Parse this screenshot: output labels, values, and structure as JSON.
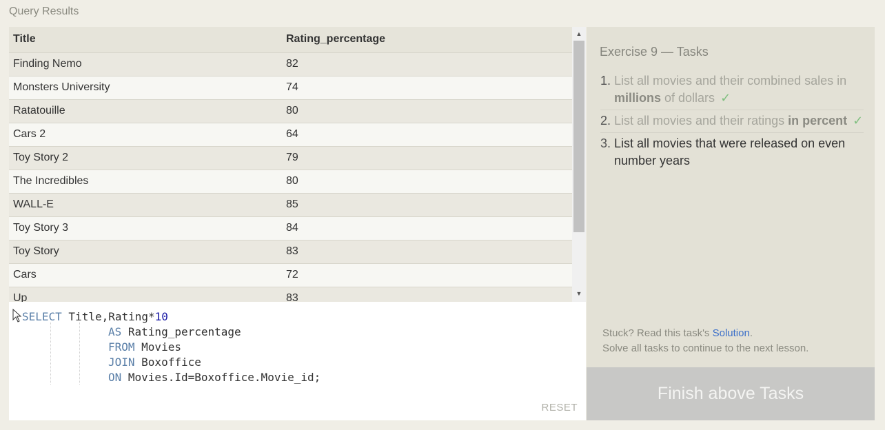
{
  "results": {
    "label": "Query Results",
    "columns": [
      "Title",
      "Rating_percentage"
    ],
    "rows": [
      [
        "Finding Nemo",
        "82"
      ],
      [
        "Monsters University",
        "74"
      ],
      [
        "Ratatouille",
        "80"
      ],
      [
        "Cars 2",
        "64"
      ],
      [
        "Toy Story 2",
        "79"
      ],
      [
        "The Incredibles",
        "80"
      ],
      [
        "WALL-E",
        "85"
      ],
      [
        "Toy Story 3",
        "84"
      ],
      [
        "Toy Story",
        "83"
      ],
      [
        "Cars",
        "72"
      ],
      [
        "Up",
        "83"
      ]
    ]
  },
  "editor": {
    "line1_kw": "SELECT",
    "line1_rest": " Title,Rating*",
    "line1_num": "10",
    "line2_kw": "AS",
    "line2_rest": " Rating_percentage",
    "line3_kw": "FROM",
    "line3_rest": " Movies",
    "line4_kw": "JOIN",
    "line4_rest": " Boxoffice",
    "line5_kw": "ON",
    "line5_rest": " Movies.Id=Boxoffice.Movie_id;",
    "reset_label": "RESET"
  },
  "tasks": {
    "title": "Exercise 9 — Tasks",
    "items": [
      {
        "num": "1.",
        "pre": "List all movies and their combined sales in ",
        "bold": "millions",
        "post": " of dollars",
        "done": true
      },
      {
        "num": "2.",
        "pre": "List all movies and their ratings ",
        "bold": "in percent",
        "post": "",
        "done": true
      },
      {
        "num": "3.",
        "pre": "List all movies that were released on even number years",
        "bold": "",
        "post": "",
        "done": false
      }
    ],
    "check_mark": "✓",
    "stuck_prefix": "Stuck? Read this task's ",
    "solution_link": "Solution",
    "stuck_suffix": ".",
    "continue_text": "Solve all tasks to continue to the next lesson.",
    "finish_label": "Finish above Tasks"
  }
}
